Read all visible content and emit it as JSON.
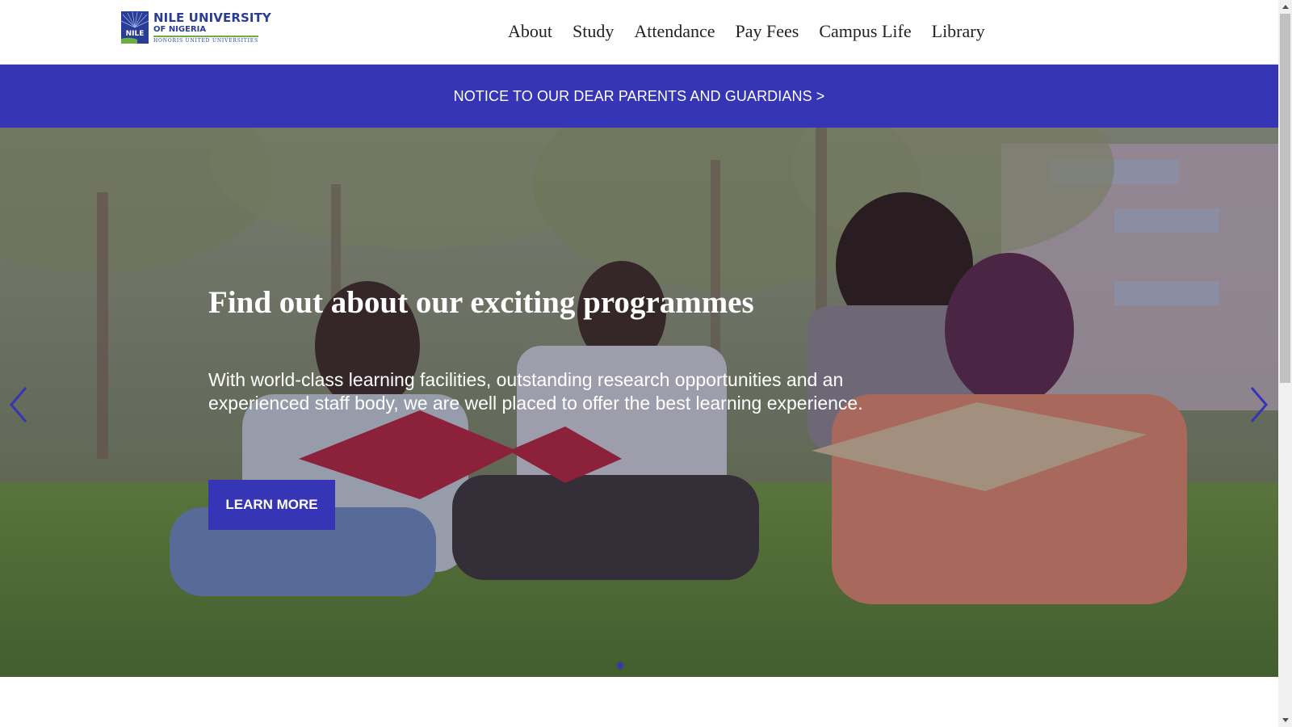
{
  "header": {
    "logo": {
      "badge_text": "NILE",
      "line1": "NILE UNIVERSITY",
      "line2": "OF NIGERIA",
      "line3": "HONORIS UNITED UNIVERSITIES"
    },
    "nav": [
      {
        "label": "About"
      },
      {
        "label": "Study"
      },
      {
        "label": "Attendance"
      },
      {
        "label": "Pay Fees"
      },
      {
        "label": "Campus Life"
      },
      {
        "label": "Library"
      }
    ]
  },
  "notice": {
    "text": "NOTICE TO OUR DEAR PARENTS AND GUARDIANS >"
  },
  "hero": {
    "title": "Find out about our exciting programmes",
    "description": "With world-class learning facilities, outstanding research opportunities and an experienced staff body, we are well placed to offer the best learning experience.",
    "button_label": "LEARN MORE",
    "prev_icon": "chevron-left-icon",
    "next_icon": "chevron-right-icon",
    "active_slide": 1,
    "slide_count": 1
  },
  "colors": {
    "brand_blue": "#3535b5",
    "logo_blue": "#2a3d96",
    "logo_green": "#6cae3f",
    "nav_text": "#222222"
  }
}
